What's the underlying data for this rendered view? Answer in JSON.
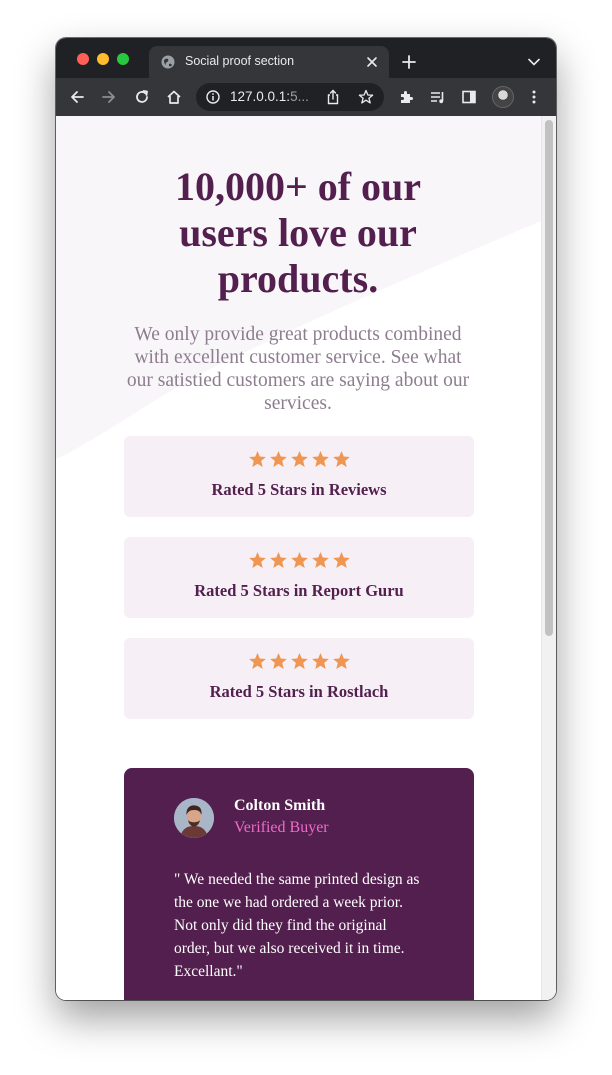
{
  "browser": {
    "tab_title": "Social proof section",
    "url_visible": "127.0.0.1:",
    "url_faded": "5...",
    "icons": {
      "traffic_lights": [
        "close-light",
        "minimize-light",
        "maximize-light"
      ],
      "tab_favicon": "globe-icon",
      "tab_close": "close-icon",
      "new_tab": "plus-icon",
      "tab_search": "chevron-down-icon",
      "toolbar": [
        "back-arrow-icon",
        "forward-arrow-icon",
        "reload-icon",
        "home-icon",
        "info-icon",
        "share-icon",
        "star-icon",
        "extensions-puzzle-icon",
        "media-playlist-icon",
        "side-panel-icon",
        "profile-avatar",
        "kebab-menu-icon"
      ]
    }
  },
  "page": {
    "headline": "10,000+ of our users love our products.",
    "subtext": "We only provide great products combined with excellent customer service. See what our satistied customers are saying about our services.",
    "ratings": [
      {
        "stars": 5,
        "label": "Rated 5 Stars in Reviews"
      },
      {
        "stars": 5,
        "label": "Rated 5 Stars in Report Guru"
      },
      {
        "stars": 5,
        "label": "Rated 5 Stars in Rostlach"
      }
    ],
    "testimonial": {
      "name": "Colton Smith",
      "badge": "Verified Buyer",
      "quote": "\" We needed the same printed design as the one we had ordered a week prior. Not only did they find the original order, but we also received it in time. Excellant.\""
    }
  },
  "colors": {
    "chrome_dark": "#202124",
    "chrome_toolbar": "#35363a",
    "headline": "#521f4e",
    "subtext": "#8d7d8f",
    "rating_bg": "#f6f0f6",
    "star": "#ef9652",
    "testimonial_bg": "#521f4e",
    "badge": "#ee6bc9"
  }
}
